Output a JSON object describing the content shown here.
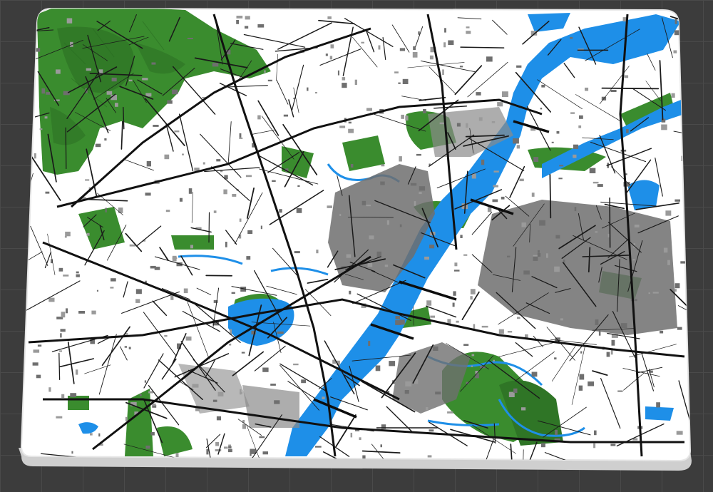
{
  "scene": {
    "description_free": true,
    "colors": {
      "background": "#3c3c3c",
      "grid_line": "#4a4a4a",
      "plate": "#ffffff",
      "plate_edge": "#d9d9d9",
      "water": "#1e8fe8",
      "green": "#3a8c2e",
      "green_dark": "#2f7526",
      "roads": "#1a1a1a",
      "buildings": "#6f6f6f",
      "buildings_light": "#9a9a9a"
    },
    "layers": [
      "plate",
      "river",
      "lakes",
      "parks",
      "hills",
      "roads",
      "rail",
      "buildings"
    ]
  }
}
